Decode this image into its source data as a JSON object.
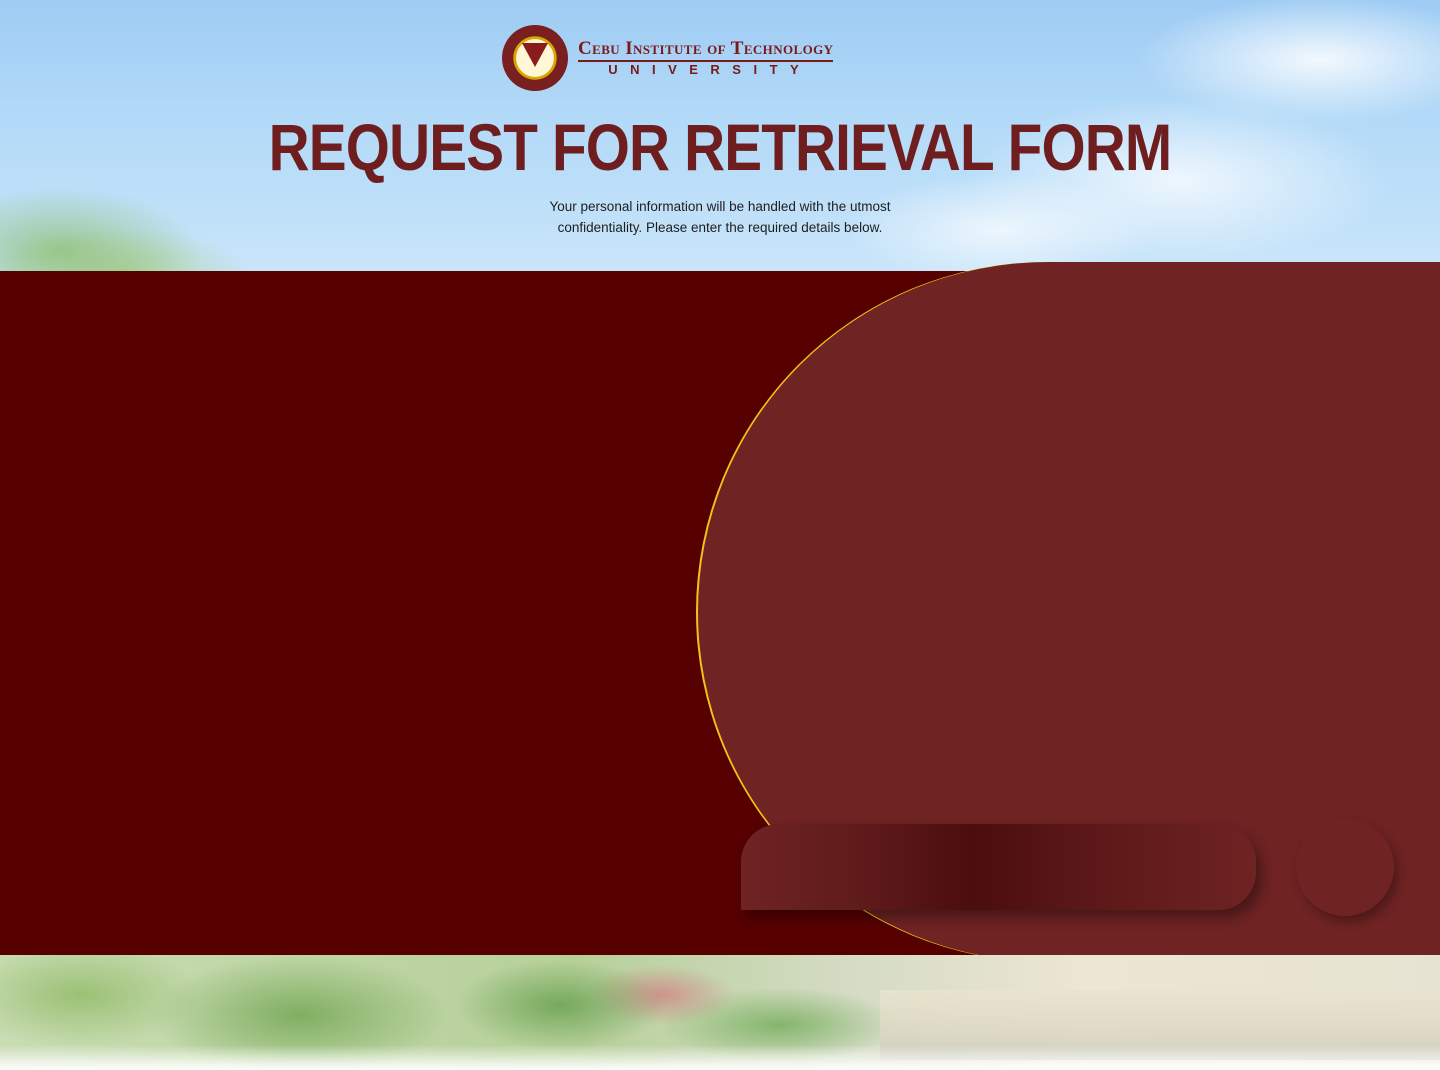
{
  "header": {
    "institution_name_line1": "Cebu Institute of Technology",
    "institution_name_line2": "UNIVERSITY",
    "seal_icon": "university-seal-icon",
    "title": "REQUEST FOR RETRIEVAL FORM",
    "subtitle": "Your personal information will be handled with the utmost confidentiality. Please enter the required details below."
  },
  "colors": {
    "maroon_dark": "#560000",
    "maroon_panel": "#6f2323",
    "title_maroon": "#6e1e1e",
    "accent_gold": "#f3c318"
  }
}
